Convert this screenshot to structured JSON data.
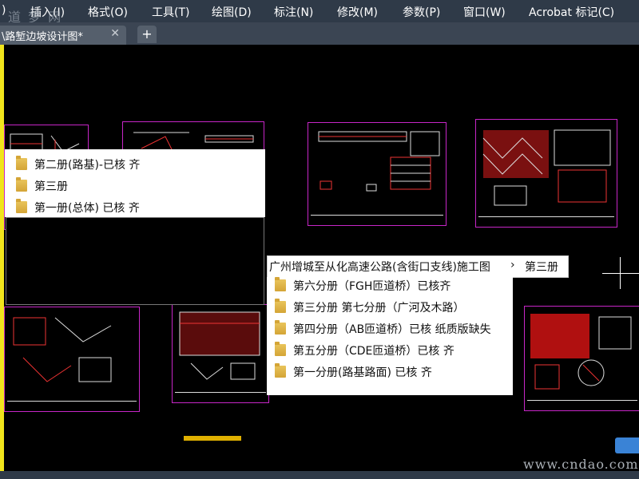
{
  "watermark_top": "道 梦 网",
  "watermark_bottom": "www.cndao.com",
  "menu": [
    ")",
    "插入(I)",
    "格式(O)",
    "工具(T)",
    "绘图(D)",
    "标注(N)",
    "修改(M)",
    "参数(P)",
    "窗口(W)",
    "Acrobat 标记(C)"
  ],
  "tab": {
    "label": "\\路堑边坡设计图*",
    "close": "✕",
    "add": "+"
  },
  "left_list": [
    "第二册(路基)-已核 齐",
    "第三册",
    "第一册(总体) 已核 齐"
  ],
  "breadcrumb": {
    "parent": "广州增城至从化高速公路(含街口支线)施工图",
    "separator": "›",
    "current": "第三册"
  },
  "right_list": [
    "第六分册（FGH匝道桥）已核齐",
    "第三分册 第七分册（广河及木路）",
    "第四分册（AB匝道桥）已核  纸质版缺失",
    "第五分册（CDE匝道桥）已核 齐",
    "第一分册(路基路面) 已核 齐"
  ],
  "colors": {
    "frame": "#c726c7",
    "accent": "#f1e51c",
    "folder": "#e9c45b"
  }
}
